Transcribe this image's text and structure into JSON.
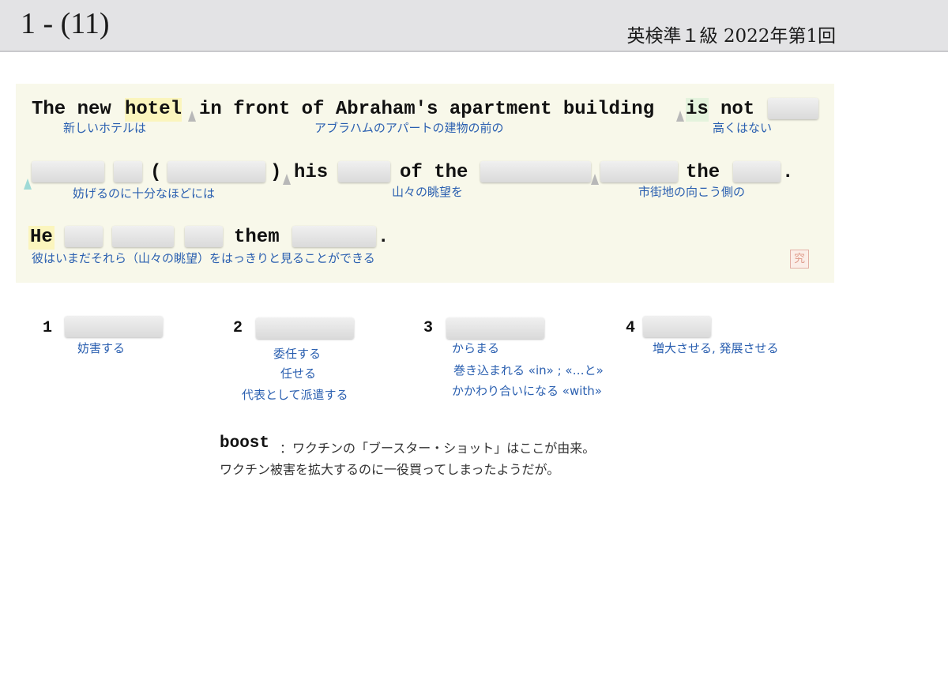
{
  "header": {
    "question_number": "1 - (11)",
    "exam_label": "英検準１級  2022年第1回"
  },
  "passage": {
    "line1": {
      "w1": "The new ",
      "w2": "hotel",
      "w3": "in front of Abraham's apartment building",
      "w4": "is",
      "w5": "not"
    },
    "line2": {
      "paren_open": "(",
      "paren_close": ")",
      "w_his": "his",
      "w_of_the": "of the",
      "w_the": "the",
      "period": "."
    },
    "line3": {
      "w_he": "He",
      "w_them": "them",
      "period": "."
    },
    "glosses": {
      "g1": "新しいホテルは",
      "g2": "アブラハムのアパートの建物の前の",
      "g3": "高くはない",
      "g4": "妨げるのに十分なほどには",
      "g5": "山々の眺望を",
      "g6": "市街地の向こう側の",
      "g7": "彼はいまだそれら（山々の眺望）をはっきりと見ることができる"
    },
    "seal_char": "究"
  },
  "choices": [
    {
      "num": "1",
      "meanings": [
        "妨害する"
      ]
    },
    {
      "num": "2",
      "meanings": [
        "委任する",
        "任せる",
        "代表として派遣する"
      ]
    },
    {
      "num": "3",
      "meanings": [
        "からまる",
        "巻き込まれる «in» ; «…と»",
        "かかわり合いになる «with»"
      ]
    },
    {
      "num": "4",
      "meanings": [
        "増大させる, 発展させる"
      ]
    }
  ],
  "note": {
    "word": "boost",
    "line1": "：ワクチンの「ブースター・ショット」はここが由来。",
    "line2": "ワクチン被害を拡大するのに一役買ってしまったようだが。"
  }
}
